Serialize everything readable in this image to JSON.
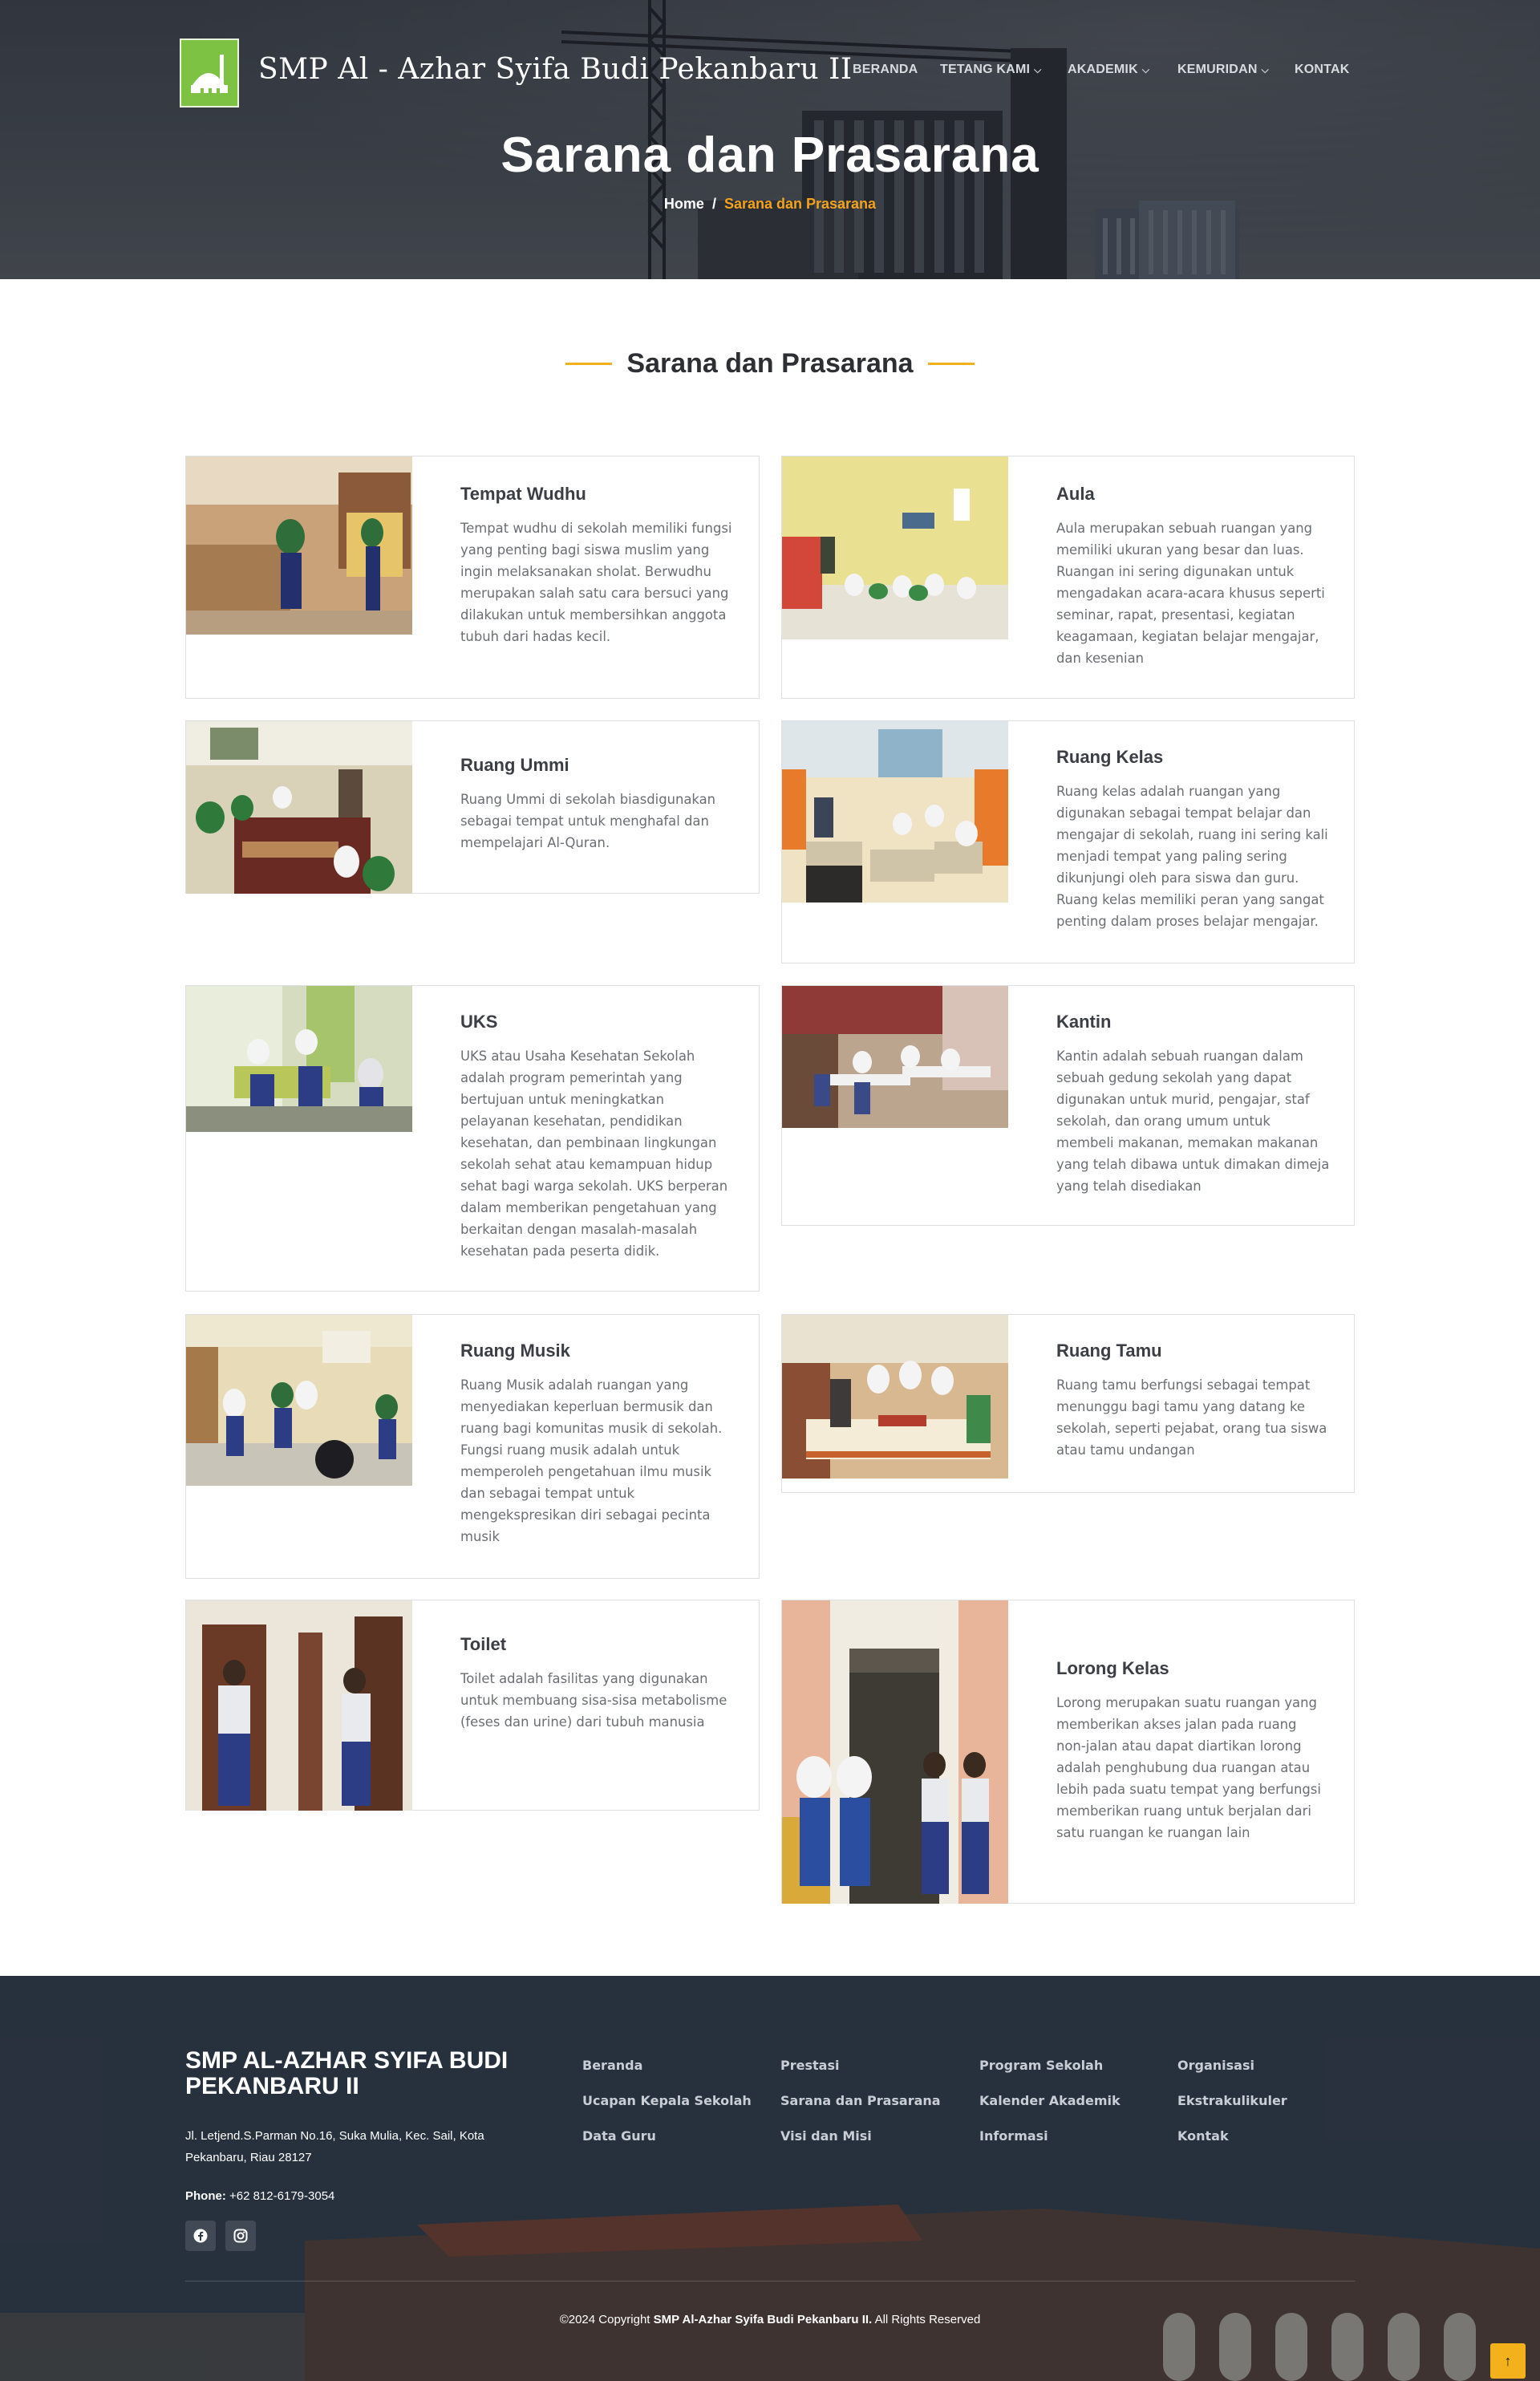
{
  "header": {
    "site_title": "SMP Al - Azhar Syifa Budi Pekanbaru II",
    "nav": [
      {
        "label": "BERANDA",
        "dropdown": false
      },
      {
        "label": "TETANG KAMI",
        "dropdown": true
      },
      {
        "label": "AKADEMIK",
        "dropdown": true
      },
      {
        "label": "KEMURIDAN",
        "dropdown": true
      },
      {
        "label": "KONTAK",
        "dropdown": false
      }
    ]
  },
  "hero": {
    "title": "Sarana dan Prasarana",
    "breadcrumb": {
      "home": "Home",
      "separator": "/",
      "current": "Sarana dan Prasarana"
    }
  },
  "section": {
    "title": "Sarana dan Prasarana",
    "accent_color": "#f2b01a"
  },
  "facilities": [
    {
      "title": "Tempat Wudhu",
      "description": "Tempat wudhu di sekolah memiliki fungsi yang penting bagi siswa muslim yang ingin melaksanakan sholat. Berwudhu merupakan salah satu cara bersuci yang dilakukan untuk membersihkan anggota tubuh dari hadas kecil."
    },
    {
      "title": "Aula",
      "description": "Aula merupakan sebuah ruangan yang memiliki ukuran yang besar dan luas. Ruangan ini sering digunakan untuk mengadakan acara-acara khusus seperti seminar, rapat, presentasi, kegiatan keagamaan, kegiatan belajar mengajar, dan kesenian"
    },
    {
      "title": "Ruang Ummi",
      "description": "Ruang Ummi di sekolah biasdigunakan sebagai tempat untuk menghafal dan mempelajari Al-Quran."
    },
    {
      "title": "Ruang Kelas",
      "description": "Ruang kelas adalah ruangan yang digunakan sebagai tempat belajar dan mengajar di sekolah, ruang ini sering kali menjadi tempat yang paling sering dikunjungi oleh para siswa dan guru. Ruang kelas memiliki peran yang sangat penting dalam proses belajar mengajar."
    },
    {
      "title": "UKS",
      "description": "UKS atau Usaha Kesehatan Sekolah adalah program pemerintah yang bertujuan untuk meningkatkan pelayanan kesehatan, pendidikan kesehatan, dan pembinaan lingkungan sekolah sehat atau kemampuan hidup sehat bagi warga sekolah. UKS berperan dalam memberikan pengetahuan yang berkaitan dengan masalah-masalah kesehatan pada peserta didik."
    },
    {
      "title": "Kantin",
      "description": "Kantin adalah sebuah ruangan dalam sebuah gedung sekolah yang dapat digunakan untuk murid, pengajar, staf sekolah, dan orang umum untuk membeli makanan, memakan makanan yang telah dibawa untuk dimakan dimeja yang telah disediakan"
    },
    {
      "title": "Ruang Musik",
      "description": "Ruang Musik adalah ruangan yang menyediakan keperluan bermusik dan ruang bagi komunitas musik di sekolah. Fungsi ruang musik adalah untuk memperoleh pengetahuan ilmu musik dan sebagai tempat untuk mengekspresikan diri sebagai pecinta musik"
    },
    {
      "title": "Ruang Tamu",
      "description": "Ruang tamu berfungsi sebagai tempat menunggu bagi tamu yang datang ke sekolah, seperti pejabat, orang tua siswa atau tamu undangan"
    },
    {
      "title": "Toilet",
      "description": "Toilet adalah fasilitas yang digunakan untuk membuang sisa-sisa metabolisme (feses dan urine) dari tubuh manusia"
    },
    {
      "title": "Lorong Kelas",
      "description": "Lorong merupakan suatu ruangan yang memberikan akses jalan pada ruang non-jalan atau dapat diartikan lorong adalah penghubung dua ruangan atau lebih pada suatu tempat yang berfungsi memberikan ruang untuk berjalan dari satu ruangan ke ruangan lain"
    }
  ],
  "footer": {
    "brand": "SMP AL-AZHAR SYIFA BUDI PEKANBARU II",
    "address": "Jl. Letjend.S.Parman No.16, Suka Mulia, Kec. Sail, Kota Pekanbaru, Riau 28127",
    "phone_label": "Phone:",
    "phone": "+62 812-6179-3054",
    "social": [
      "facebook-icon",
      "instagram-icon"
    ],
    "links": [
      "Beranda",
      "Prestasi",
      "Program Sekolah",
      "Organisasi",
      "Ucapan Kepala Sekolah",
      "Sarana dan Prasarana",
      "Kalender Akademik",
      "Ekstrakulikuler",
      "Data Guru",
      "Visi dan Misi",
      "Informasi",
      "Kontak"
    ],
    "copyright_prefix": "©2024 Copyright",
    "copyright_name": "SMP Al-Azhar Syifa Budi Pekanbaru II.",
    "copyright_suffix": "All Rights Reserved"
  },
  "back_to_top": "↑",
  "colors": {
    "accent": "#f3a31b",
    "logo_green": "#7dc242",
    "footer_bg": "#2c3744"
  }
}
